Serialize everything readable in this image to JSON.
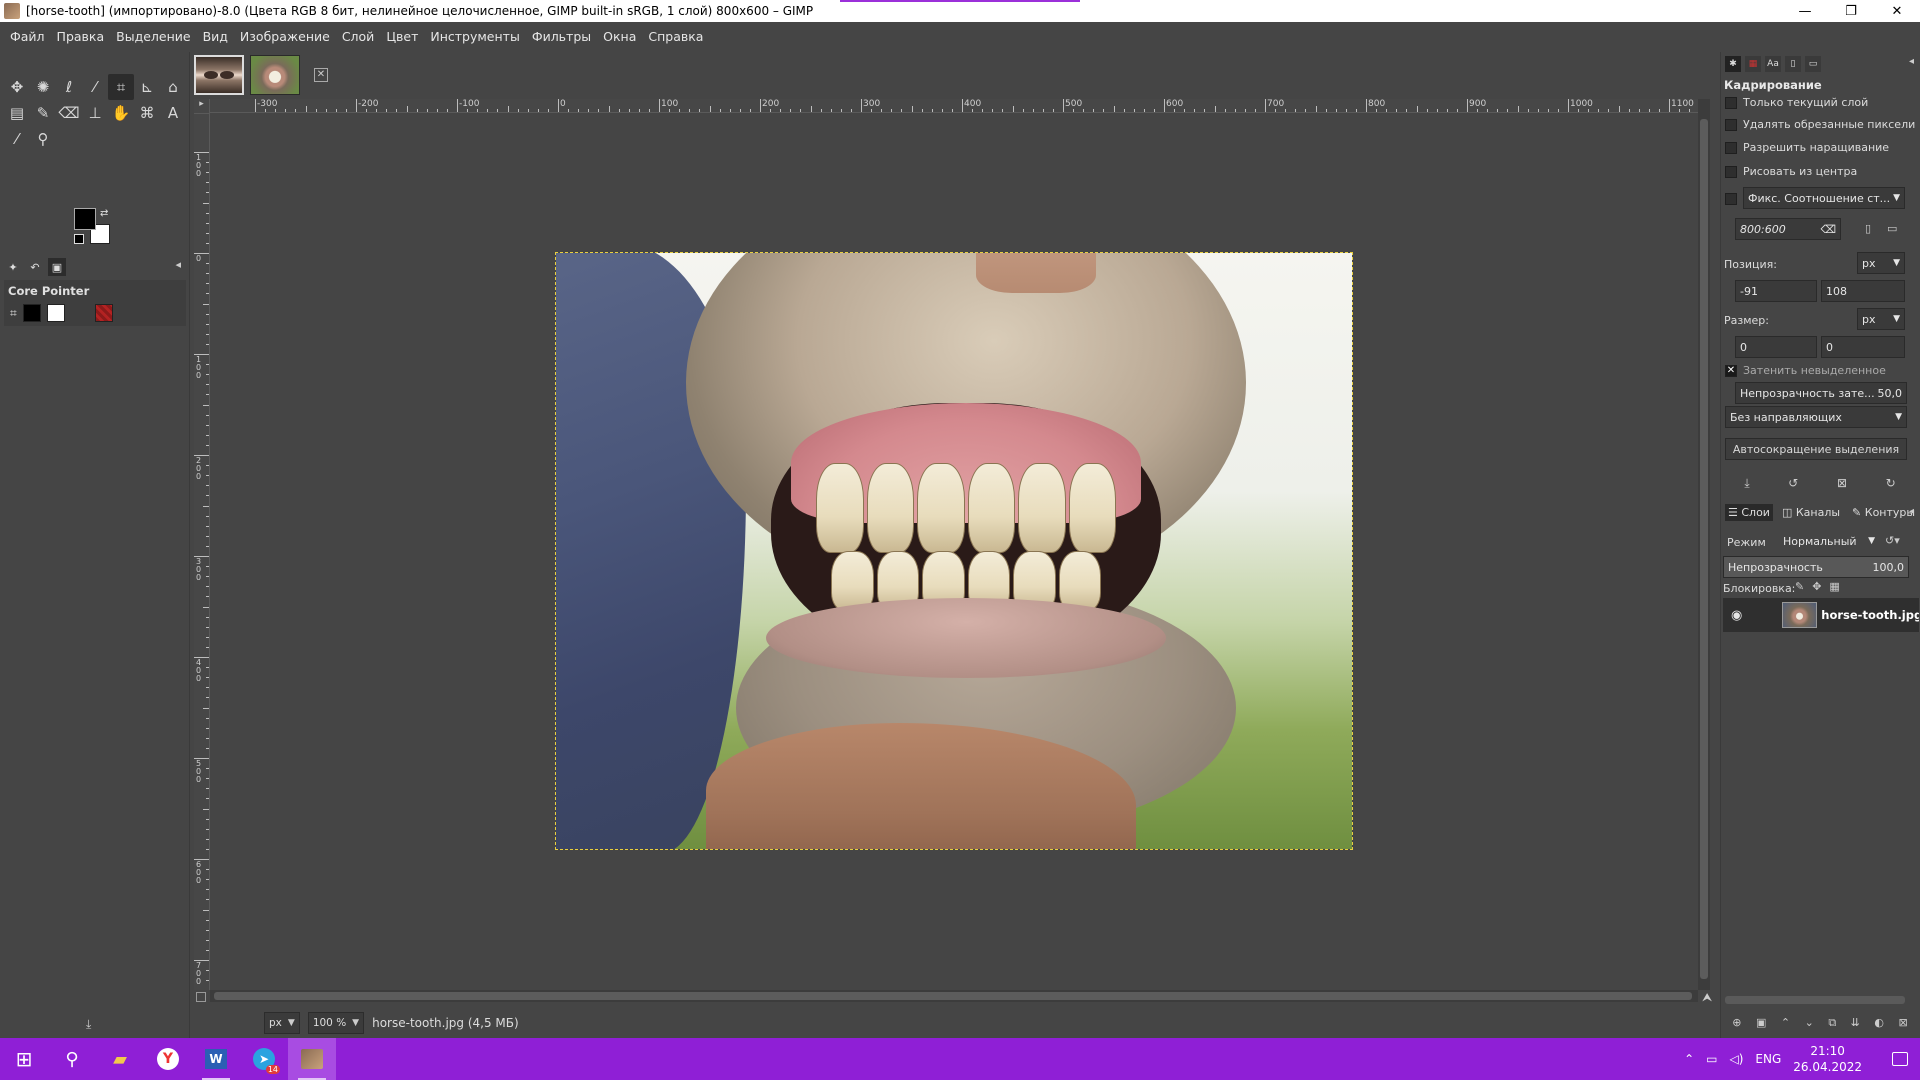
{
  "window": {
    "title": "[horse-tooth] (импортировано)-8.0 (Цвета RGB 8 бит, нелинейное целочисленное, GIMP built-in sRGB, 1 слой) 800x600 – GIMP",
    "minimize": "—",
    "maximize": "❐",
    "close": "✕"
  },
  "menu": [
    "Файл",
    "Правка",
    "Выделение",
    "Вид",
    "Изображение",
    "Слой",
    "Цвет",
    "Инструменты",
    "Фильтры",
    "Окна",
    "Справка"
  ],
  "toolbox": {
    "tools": [
      {
        "name": "move-tool-icon",
        "glyph": "✥"
      },
      {
        "name": "fuzzy-select-icon",
        "glyph": "✺"
      },
      {
        "name": "lasso-icon",
        "glyph": "ℓ"
      },
      {
        "name": "wand-icon",
        "glyph": "⁄"
      },
      {
        "name": "crop-icon",
        "glyph": "⌗"
      },
      {
        "name": "align-icon",
        "glyph": "⊾"
      },
      {
        "name": "warp-icon",
        "glyph": "⌂"
      },
      {
        "name": "gradient-icon",
        "glyph": "▤"
      },
      {
        "name": "paintbrush-icon",
        "glyph": "✎"
      },
      {
        "name": "eraser-icon",
        "glyph": "⌫"
      },
      {
        "name": "clone-icon",
        "glyph": "⊥"
      },
      {
        "name": "smudge-icon",
        "glyph": "✋"
      },
      {
        "name": "paths-icon",
        "glyph": "⌘"
      },
      {
        "name": "text-icon",
        "glyph": "A"
      },
      {
        "name": "color-picker-icon",
        "glyph": "⁄"
      },
      {
        "name": "zoom-icon",
        "glyph": "⚲"
      }
    ],
    "device_status_title": "Core Pointer"
  },
  "rulers": {
    "horizontal": [
      "-300",
      "-200",
      "-100",
      "0",
      "100",
      "200",
      "300",
      "400",
      "500",
      "600",
      "700",
      "800",
      "900",
      "1000",
      "1100"
    ],
    "vertical": [
      "1 0 0",
      "0",
      "1 0 0",
      "2 0 0",
      "3 0 0",
      "4 0 0",
      "5 0 0",
      "6 0 0",
      "7 0 0"
    ]
  },
  "status": {
    "unit": "px",
    "zoom": "100 %",
    "file": "horse-tooth.jpg (4,5 МБ)"
  },
  "tool_options": {
    "title": "Кадрирование",
    "only_current_layer": "Только текущий слой",
    "delete_cropped": "Удалять обрезанные пиксели",
    "allow_growing": "Разрешить наращивание",
    "expand_from_center": "Рисовать из центра",
    "fixed": "Фикс. Соотношение ст...",
    "ratio_value": "800:600",
    "position_label": "Позиция:",
    "position_unit": "px",
    "position_x": "-91",
    "position_y": "108",
    "size_label": "Размер:",
    "size_unit": "px",
    "size_w": "0",
    "size_h": "0",
    "highlight": "Затенить невыделенное",
    "highlight_opacity_label": "Непрозрачность зате...",
    "highlight_opacity_value": "50,0",
    "guides": "Без направляющих",
    "auto_shrink": "Автосокращение выделения"
  },
  "layers": {
    "tabs": [
      "Слои",
      "Каналы",
      "Контуры"
    ],
    "mode_label": "Режим",
    "mode_value": "Нормальный",
    "opacity_label": "Непрозрачность",
    "opacity_value": "100,0",
    "lock_label": "Блокировка:",
    "layer_name": "horse-tooth.jpg"
  },
  "taskbar": {
    "lang": "ENG",
    "time": "21:10",
    "date": "26.04.2022",
    "telegram_badge": "14"
  }
}
